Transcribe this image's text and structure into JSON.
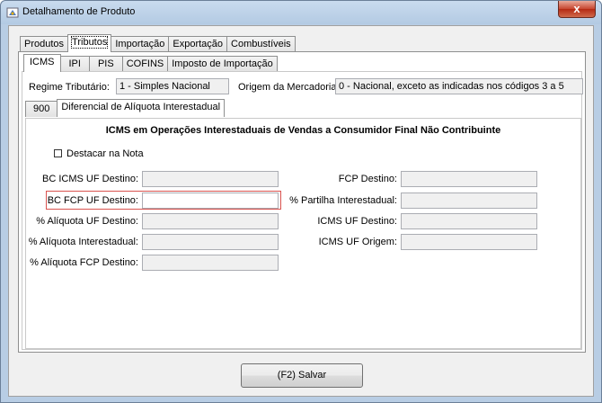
{
  "window": {
    "title": "Detalhamento de Produto",
    "close_glyph": "x"
  },
  "main_tabs": [
    {
      "label": "Produtos"
    },
    {
      "label": "Tributos"
    },
    {
      "label": "Importação"
    },
    {
      "label": "Exportação"
    },
    {
      "label": "Combustíveis"
    }
  ],
  "tax_tabs": [
    {
      "label": "ICMS"
    },
    {
      "label": "IPI"
    },
    {
      "label": "PIS"
    },
    {
      "label": "COFINS"
    },
    {
      "label": "Imposto de Importação"
    }
  ],
  "regime": {
    "label": "Regime Tributário:",
    "value": "1 - Simples Nacional"
  },
  "origem": {
    "label": "Origem da Mercadoria:",
    "value": "0 - Nacional, exceto as indicadas nos códigos 3 a 5"
  },
  "sub_tabs": [
    {
      "label": "900"
    },
    {
      "label": "Diferencial de Alíquota Interestadual"
    }
  ],
  "section": {
    "title": "ICMS em Operações Interestaduais de Vendas a Consumidor Final Não Contribuinte",
    "destacar_label": "Destacar na Nota"
  },
  "left_fields": [
    {
      "label": "BC ICMS UF Destino:"
    },
    {
      "label": "BC FCP UF Destino:"
    },
    {
      "label": "% Alíquota UF Destino:"
    },
    {
      "label": "% Alíquota Interestadual:"
    },
    {
      "label": "% Alíquota FCP Destino:"
    }
  ],
  "right_fields": [
    {
      "label": "FCP Destino:"
    },
    {
      "label": "% Partilha Interestadual:"
    },
    {
      "label": "ICMS UF Destino:"
    },
    {
      "label": "ICMS UF Origem:"
    }
  ],
  "save_button": {
    "label": "(F2) Salvar"
  },
  "colors": {
    "highlight": "#d9534f",
    "window_frame": "#b8cde4"
  }
}
